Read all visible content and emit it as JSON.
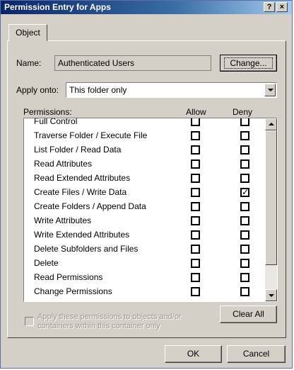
{
  "window": {
    "title": "Permission Entry for Apps",
    "help_button": "?",
    "close_button": "×"
  },
  "tabs": [
    {
      "label": "Object"
    }
  ],
  "name_row": {
    "label": "Name:",
    "value": "Authenticated Users",
    "change_button": "Change..."
  },
  "apply_onto": {
    "label": "Apply onto:",
    "selected": "This folder only"
  },
  "permissions": {
    "header": "Permissions:",
    "allow_header": "Allow",
    "deny_header": "Deny",
    "rows": [
      {
        "name": "Full Control",
        "allow": false,
        "deny": false
      },
      {
        "name": "Traverse Folder / Execute File",
        "allow": false,
        "deny": false
      },
      {
        "name": "List Folder / Read Data",
        "allow": false,
        "deny": false
      },
      {
        "name": "Read Attributes",
        "allow": false,
        "deny": false
      },
      {
        "name": "Read Extended Attributes",
        "allow": false,
        "deny": false
      },
      {
        "name": "Create Files / Write Data",
        "allow": false,
        "deny": true
      },
      {
        "name": "Create Folders / Append Data",
        "allow": false,
        "deny": false
      },
      {
        "name": "Write Attributes",
        "allow": false,
        "deny": false
      },
      {
        "name": "Write Extended Attributes",
        "allow": false,
        "deny": false
      },
      {
        "name": "Delete Subfolders and Files",
        "allow": false,
        "deny": false
      },
      {
        "name": "Delete",
        "allow": false,
        "deny": false
      },
      {
        "name": "Read Permissions",
        "allow": false,
        "deny": false
      },
      {
        "name": "Change Permissions",
        "allow": false,
        "deny": false
      }
    ]
  },
  "apply_checkbox": {
    "line1": "Apply these permissions to objects and/or",
    "line2": "containers within this container only",
    "checked": false
  },
  "clear_all_button": "Clear All",
  "ok_button": "OK",
  "cancel_button": "Cancel"
}
